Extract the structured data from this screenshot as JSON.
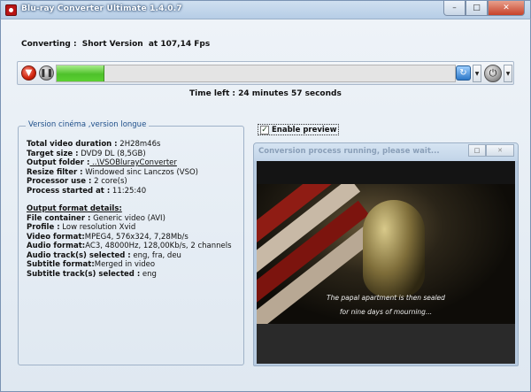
{
  "window": {
    "title": "Blu-ray Converter Ultimate 1.4.0.7",
    "buttons": {
      "minimize": "–",
      "maximize": "□",
      "close": "✕"
    }
  },
  "status": {
    "label": "Converting :",
    "item": "Short Version",
    "speed": "at 107,14 Fps"
  },
  "toolbar": {
    "progress_fraction": 0.12,
    "stop_icon": "stop-icon",
    "pause_icon": "pause-icon",
    "refresh_icon": "refresh-icon",
    "power_icon": "power-icon"
  },
  "time_left": {
    "label": "Time left :",
    "value": "24 minutes 57 seconds"
  },
  "group": {
    "title": "Version cinéma ,version longue",
    "rows": [
      {
        "label": "Total video duration :",
        "value": " 2H28m46s"
      },
      {
        "label": "Target size :",
        "value": " DVD9 DL (8,5GB)"
      },
      {
        "label": "Output folder :",
        "value": " ..\\VSOBlurayConverter"
      },
      {
        "label": "Resize filter :",
        "value": " Windowed sinc Lanczos (VSO)"
      },
      {
        "label": "Processor use :",
        "value": " 2 core(s)"
      },
      {
        "label": "Process started at :",
        "value": " 11:25:40"
      }
    ],
    "output_heading": "Output format details:",
    "output_rows": [
      {
        "label": "File container :",
        "value": " Generic video (AVI)"
      },
      {
        "label": "Profile :",
        "value": " Low resolution Xvid"
      },
      {
        "label": "Video format:",
        "value": "MPEG4, 576x324, 7,28Mb/s"
      },
      {
        "label": "Audio format:",
        "value": "AC3, 48000Hz, 128,00Kb/s, 2 channels"
      },
      {
        "label": "Audio track(s) selected :",
        "value": "  eng, fra, deu"
      },
      {
        "label": "Subtitle format:",
        "value": "Merged in video"
      },
      {
        "label": "Subtitle track(s) selected :",
        "value": "  eng"
      }
    ]
  },
  "preview": {
    "checkbox_label": "Enable preview",
    "checked": true,
    "window_title": "Conversion process running, please wait...",
    "subtitle_line1": "The papal apartment is then sealed",
    "subtitle_line2": "for nine days of mourning..."
  }
}
